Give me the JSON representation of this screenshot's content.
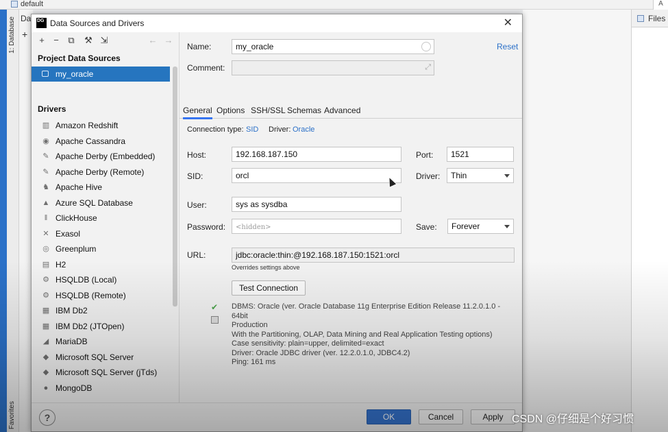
{
  "ide": {
    "project_label": "default",
    "database_tab": "1: Database",
    "favorites_tab": "Favorites",
    "panel_title_partial": "Da",
    "files_tab": "Files"
  },
  "dialog": {
    "title": "Data Sources and Drivers",
    "logo_text": "DG",
    "sections": {
      "project_sources": "Project Data Sources",
      "drivers": "Drivers"
    },
    "sources": [
      {
        "label": "my_oracle",
        "icon": "database-icon",
        "selected": true
      }
    ],
    "drivers": [
      {
        "label": "Amazon Redshift",
        "icon": "redshift-icon"
      },
      {
        "label": "Apache Cassandra",
        "icon": "cassandra-icon"
      },
      {
        "label": "Apache Derby (Embedded)",
        "icon": "derby-icon"
      },
      {
        "label": "Apache Derby (Remote)",
        "icon": "derby-icon"
      },
      {
        "label": "Apache Hive",
        "icon": "hive-icon"
      },
      {
        "label": "Azure SQL Database",
        "icon": "azure-icon"
      },
      {
        "label": "ClickHouse",
        "icon": "clickhouse-icon"
      },
      {
        "label": "Exasol",
        "icon": "exasol-icon"
      },
      {
        "label": "Greenplum",
        "icon": "greenplum-icon"
      },
      {
        "label": "H2",
        "icon": "h2-icon"
      },
      {
        "label": "HSQLDB (Local)",
        "icon": "hsqldb-icon"
      },
      {
        "label": "HSQLDB (Remote)",
        "icon": "hsqldb-icon"
      },
      {
        "label": "IBM Db2",
        "icon": "db2-icon"
      },
      {
        "label": "IBM Db2 (JTOpen)",
        "icon": "db2-icon"
      },
      {
        "label": "MariaDB",
        "icon": "mariadb-icon"
      },
      {
        "label": "Microsoft SQL Server",
        "icon": "sqlserver-icon"
      },
      {
        "label": "Microsoft SQL Server (jTds)",
        "icon": "sqlserver-icon"
      },
      {
        "label": "MongoDB",
        "icon": "mongodb-icon"
      }
    ],
    "form": {
      "name_label": "Name:",
      "name_value": "my_oracle",
      "comment_label": "Comment:",
      "comment_value": "",
      "reset_label": "Reset",
      "tabs": [
        "General",
        "Options",
        "SSH/SSL",
        "Schemas",
        "Advanced"
      ],
      "active_tab": "General",
      "connection_type_label": "Connection type:",
      "connection_type_value": "SID",
      "driver_label": "Driver:",
      "driver_value": "Oracle",
      "host_label": "Host:",
      "host_value": "192.168.187.150",
      "port_label": "Port:",
      "port_value": "1521",
      "sid_label": "SID:",
      "sid_value": "orcl",
      "driver_select_label": "Driver:",
      "driver_select_value": "Thin",
      "user_label": "User:",
      "user_value": "sys as sysdba",
      "password_label": "Password:",
      "password_placeholder": "<hidden>",
      "save_label": "Save:",
      "save_value": "Forever",
      "url_label": "URL:",
      "url_value": "jdbc:oracle:thin:@192.168.187.150:1521:orcl",
      "url_hint": "Overrides settings above",
      "test_button": "Test Connection",
      "status_lines": [
        "DBMS: Oracle (ver. Oracle Database 11g Enterprise Edition Release 11.2.0.1.0 - 64bit",
        "Production",
        "With the Partitioning, OLAP, Data Mining and Real Application Testing options)",
        "Case sensitivity: plain=upper, delimited=exact",
        "Driver: Oracle JDBC driver (ver. 12.2.0.1.0, JDBC4.2)",
        "Ping: 161 ms"
      ]
    },
    "buttons": {
      "help": "?",
      "ok": "OK",
      "cancel": "Cancel",
      "apply": "Apply"
    }
  },
  "watermark": "CSDN @仔细是个好习惯",
  "colors": {
    "selection": "#2675bf",
    "link": "#2b70c8",
    "primary_button": "#3574d0",
    "success": "#4aa34a"
  }
}
